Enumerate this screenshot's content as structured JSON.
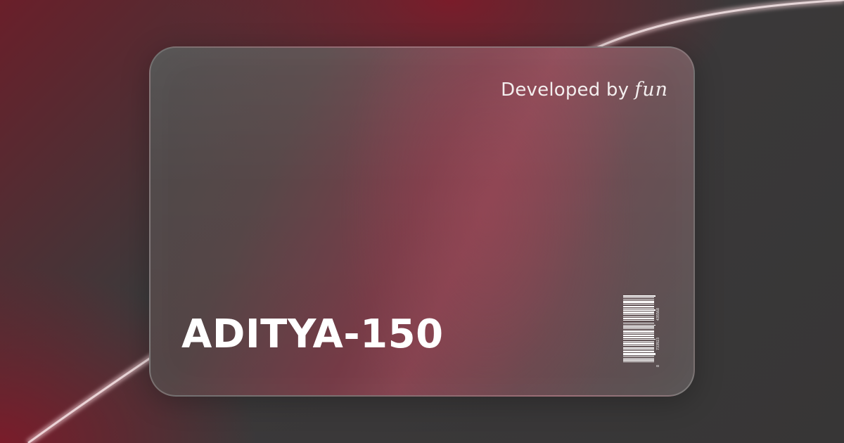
{
  "card": {
    "developer_prefix": "Developed by",
    "developer_brand": "fun",
    "title": "ADITYA-150"
  },
  "barcode": {
    "numbers": [
      "8",
      "733923",
      "435568"
    ]
  },
  "colors": {
    "background_dark": "#3a3839",
    "background_red": "#7a1c2a",
    "card_highlight": "#8b4653",
    "text": "#ffffff"
  }
}
